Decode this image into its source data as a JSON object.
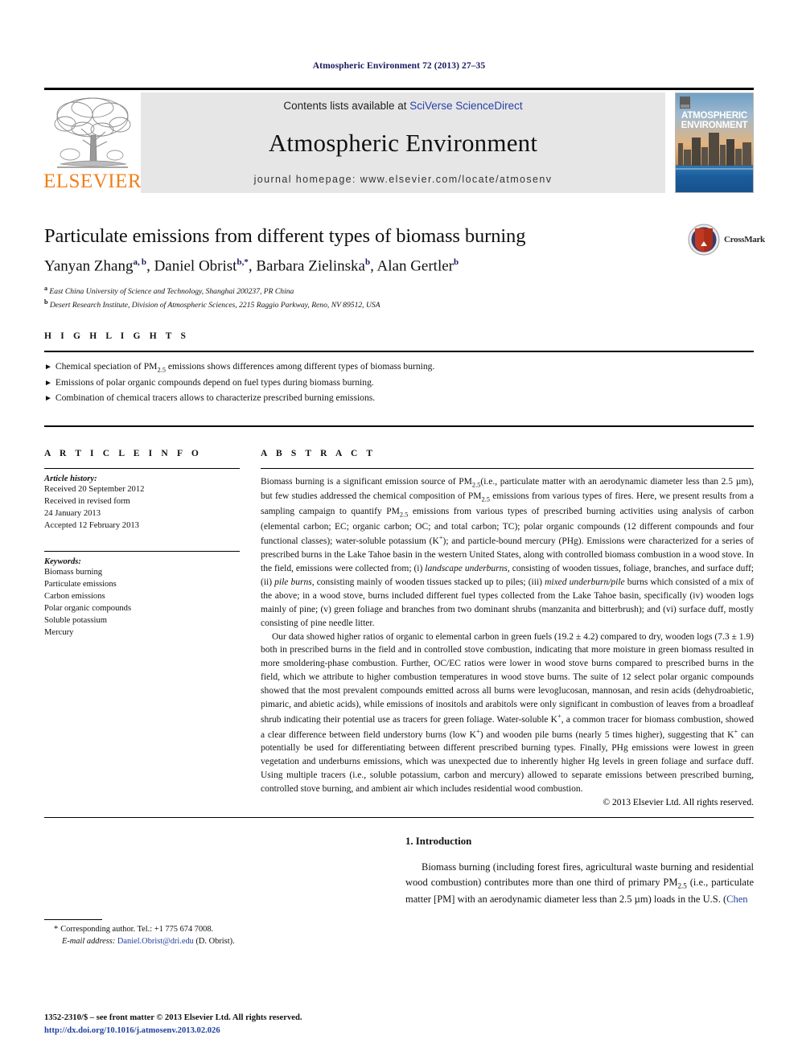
{
  "running_head": "Atmospheric Environment 72 (2013) 27–35",
  "masthead": {
    "contents_prefix": "Contents lists available at ",
    "sciencedirect": "SciVerse ScienceDirect",
    "journal_title": "Atmospheric Environment",
    "homepage": "journal homepage: www.elsevier.com/locate/atmosenv",
    "publisher_logo_word": "ELSEVIER",
    "publisher_logo_icon": "elsevier-tree-icon",
    "cover_title_line1": "ATMOSPHERIC",
    "cover_title_line2": "ENVIRONMENT",
    "accent_orange": "#f07f1a",
    "link_blue": "#2b40a8",
    "band_gray": "#e6e6e6"
  },
  "article": {
    "title": "Particulate emissions from different types of biomass burning",
    "authors_html": "Yanyan Zhang<sup>a, b</sup>, Daniel Obrist<sup>b,*</sup>, Barbara Zielinska<sup>b</sup>, Alan Gertler<sup>b</sup>",
    "affiliation_a": "East China University of Science and Technology, Shanghai 200237, PR China",
    "affiliation_b": "Desert Research Institute, Division of Atmospheric Sciences, 2215 Raggio Parkway, Reno, NV 89512, USA",
    "crossmark_label": "CrossMark",
    "crossmark_icon": "crossmark-shield-icon"
  },
  "highlights": {
    "label": "H I G H L I G H T S",
    "bullet_glyph": "►",
    "items": [
      "Chemical speciation of PM<sub>2.5</sub> emissions shows differences among different types of biomass burning.",
      "Emissions of polar organic compounds depend on fuel types during biomass burning.",
      "Combination of chemical tracers allows to characterize prescribed burning emissions."
    ]
  },
  "article_info": {
    "label": "A R T I C L E  I N F O",
    "history_title": "Article history:",
    "history_lines": [
      "Received 20 September 2012",
      "Received in revised form",
      "24 January 2013",
      "Accepted 12 February 2013"
    ],
    "keywords_title": "Keywords:",
    "keywords": [
      "Biomass burning",
      "Particulate emissions",
      "Carbon emissions",
      "Polar organic compounds",
      "Soluble potassium",
      "Mercury"
    ]
  },
  "abstract": {
    "label": "A B S T R A C T",
    "paragraph_1": "Biomass burning is a significant emission source of PM<sub>2.5</sub>(i.e., particulate matter with an aerodynamic diameter less than 2.5 µm), but few studies addressed the chemical composition of PM<sub>2.5</sub> emissions from various types of fires. Here, we present results from a sampling campaign to quantify PM<sub>2.5</sub> emissions from various types of prescribed burning activities using analysis of carbon (elemental carbon; EC; organic carbon; OC; and total carbon; TC); polar organic compounds (12 different compounds and four functional classes); water-soluble potassium (K<sup>+</sup>); and particle-bound mercury (PHg). Emissions were characterized for a series of prescribed burns in the Lake Tahoe basin in the western United States, along with controlled biomass combustion in a wood stove. In the field, emissions were collected from; (i) <i>landscape underburns</i>, consisting of wooden tissues, foliage, branches, and surface duff; (ii) <i>pile burns</i>, consisting mainly of wooden tissues stacked up to piles; (iii) <i>mixed underburn/pile</i> burns which consisted of a mix of the above; in a wood stove, burns included different fuel types collected from the Lake Tahoe basin, specifically (iv) wooden logs mainly of pine; (v) green foliage and branches from two dominant shrubs (manzanita and bitterbrush); and (vi) surface duff, mostly consisting of pine needle litter.",
    "paragraph_2": "Our data showed higher ratios of organic to elemental carbon in green fuels (19.2 ± 4.2) compared to dry, wooden logs (7.3 ± 1.9) both in prescribed burns in the field and in controlled stove combustion, indicating that more moisture in green biomass resulted in more smoldering-phase combustion. Further, OC/EC ratios were lower in wood stove burns compared to prescribed burns in the field, which we attribute to higher combustion temperatures in wood stove burns. The suite of 12 select polar organic compounds showed that the most prevalent compounds emitted across all burns were levoglucosan, mannosan, and resin acids (dehydroabietic, pimaric, and abietic acids), while emissions of inositols and arabitols were only significant in combustion of leaves from a broadleaf shrub indicating their potential use as tracers for green foliage. Water-soluble K<sup>+</sup>, a common tracer for biomass combustion, showed a clear difference between field understory burns (low K<sup>+</sup>) and wooden pile burns (nearly 5 times higher), suggesting that K<sup>+</sup> can potentially be used for differentiating between different prescribed burning types. Finally, PHg emissions were lowest in green vegetation and underburns emissions, which was unexpected due to inherently higher Hg levels in green foliage and surface duff. Using multiple tracers (i.e., soluble potassium, carbon and mercury) allowed to separate emissions between prescribed burning, controlled stove burning, and ambient air which includes residential wood combustion.",
    "copyright": "© 2013 Elsevier Ltd. All rights reserved."
  },
  "introduction": {
    "heading": "1.  Introduction",
    "paragraph_html": "Biomass burning (including forest fires, agricultural waste burning and residential wood combustion) contributes more than one third of primary PM<sub>2.5</sub> (i.e., particulate matter [PM] with an aerodynamic diameter less than 2.5 µm) loads in the U.S. (<span class=\"lnk\">Chen</span>"
  },
  "footnotes": {
    "corresponding_marker": "*",
    "corresponding_text": "Corresponding author. Tel.: +1 775 674 7008.",
    "email_label": "E-mail address:",
    "email_value": "Daniel.Obrist@dri.edu",
    "email_suffix": " (D. Obrist).",
    "issn_line": "1352-2310/$ – see front matter © 2013 Elsevier Ltd. All rights reserved.",
    "doi_line": "http://dx.doi.org/10.1016/j.atmosenv.2013.02.026",
    "link_blue": "#1f3fa0"
  }
}
